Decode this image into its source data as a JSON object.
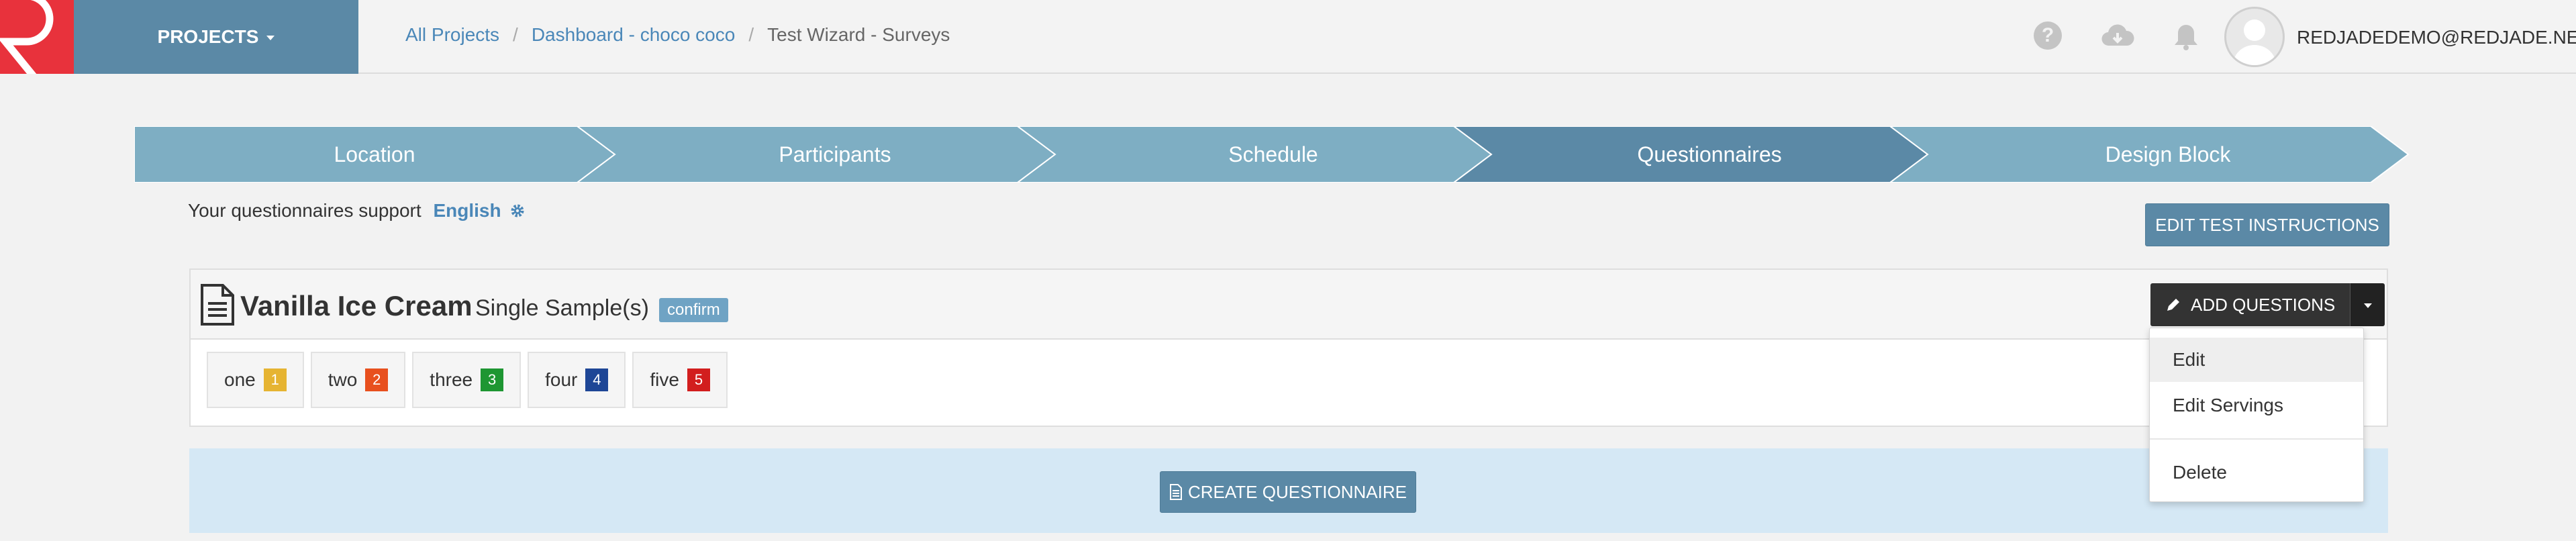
{
  "header": {
    "projects_label": "PROJECTS",
    "breadcrumb": [
      "All Projects",
      "Dashboard - choco coco",
      "Test Wizard - Surveys"
    ],
    "user": "REDJADEDEMO@REDJADE.NET",
    "help_glyph": "?",
    "icons": [
      "help-icon",
      "cloud-download-icon",
      "bell-icon",
      "user-avatar"
    ]
  },
  "steps": [
    "Location",
    "Participants",
    "Schedule",
    "Questionnaires",
    "Design Block"
  ],
  "active_step": 3,
  "support": {
    "prefix": "Your questionnaires support",
    "language": "English"
  },
  "edit_instructions_label": "EDIT TEST INSTRUCTIONS",
  "questionnaire": {
    "title": "Vanilla Ice Cream",
    "type": "Single Sample(s)",
    "badge": "confirm",
    "add_label": "ADD QUESTIONS",
    "samples": [
      {
        "label": "one",
        "num": "1",
        "color": "#e6b432"
      },
      {
        "label": "two",
        "num": "2",
        "color": "#e8501e"
      },
      {
        "label": "three",
        "num": "3",
        "color": "#1e9632"
      },
      {
        "label": "four",
        "num": "4",
        "color": "#1e4696"
      },
      {
        "label": "five",
        "num": "5",
        "color": "#d21e1e"
      }
    ]
  },
  "dropdown": [
    "Edit",
    "Edit Servings",
    "Delete"
  ],
  "create_label": "CREATE QUESTIONNAIRE",
  "colors": {
    "accent": "#5b89a6",
    "step": "#7eaec3",
    "step_active": "#5b89a6",
    "logo": "#e8323c"
  }
}
